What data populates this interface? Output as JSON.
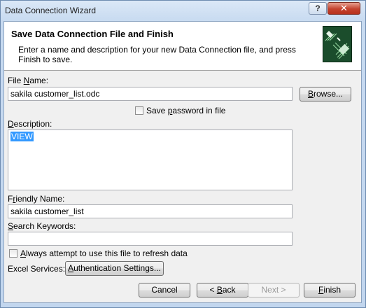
{
  "window": {
    "title": "Data Connection Wizard",
    "help_label": "?",
    "close_label": "✕"
  },
  "header": {
    "title": "Save Data Connection File and Finish",
    "description": "Enter a name and description for your new Data Connection file, and press Finish to save.",
    "icon": "data-connection-wizard-icon"
  },
  "file_name": {
    "label_pre": "File ",
    "label_key": "N",
    "label_post": "ame:",
    "value": "sakila customer_list.odc",
    "browse_pre": "",
    "browse_key": "B",
    "browse_post": "rowse..."
  },
  "save_password": {
    "label_pre": "Save ",
    "label_key": "p",
    "label_post": "assword in file",
    "checked": false
  },
  "description": {
    "label_pre": "",
    "label_key": "D",
    "label_post": "escription:",
    "value": "VIEW"
  },
  "friendly_name": {
    "label_pre": "F",
    "label_key": "r",
    "label_post": "iendly Name:",
    "value": "sakila customer_list"
  },
  "search_keywords": {
    "label_pre": "",
    "label_key": "S",
    "label_post": "earch Keywords:",
    "value": ""
  },
  "always_refresh": {
    "label_pre": "",
    "label_key": "A",
    "label_post": "lways attempt to use this file to refresh data",
    "checked": false
  },
  "excel_services": {
    "label": "Excel Services:",
    "auth_pre": "",
    "auth_key": "A",
    "auth_post": "uthentication Settings..."
  },
  "buttons": {
    "cancel": "Cancel",
    "back_pre": "< ",
    "back_key": "B",
    "back_post": "ack",
    "next_pre": "Next ",
    "next_key": "",
    "next_post": ">",
    "finish_pre": "",
    "finish_key": "F",
    "finish_post": "inish"
  }
}
